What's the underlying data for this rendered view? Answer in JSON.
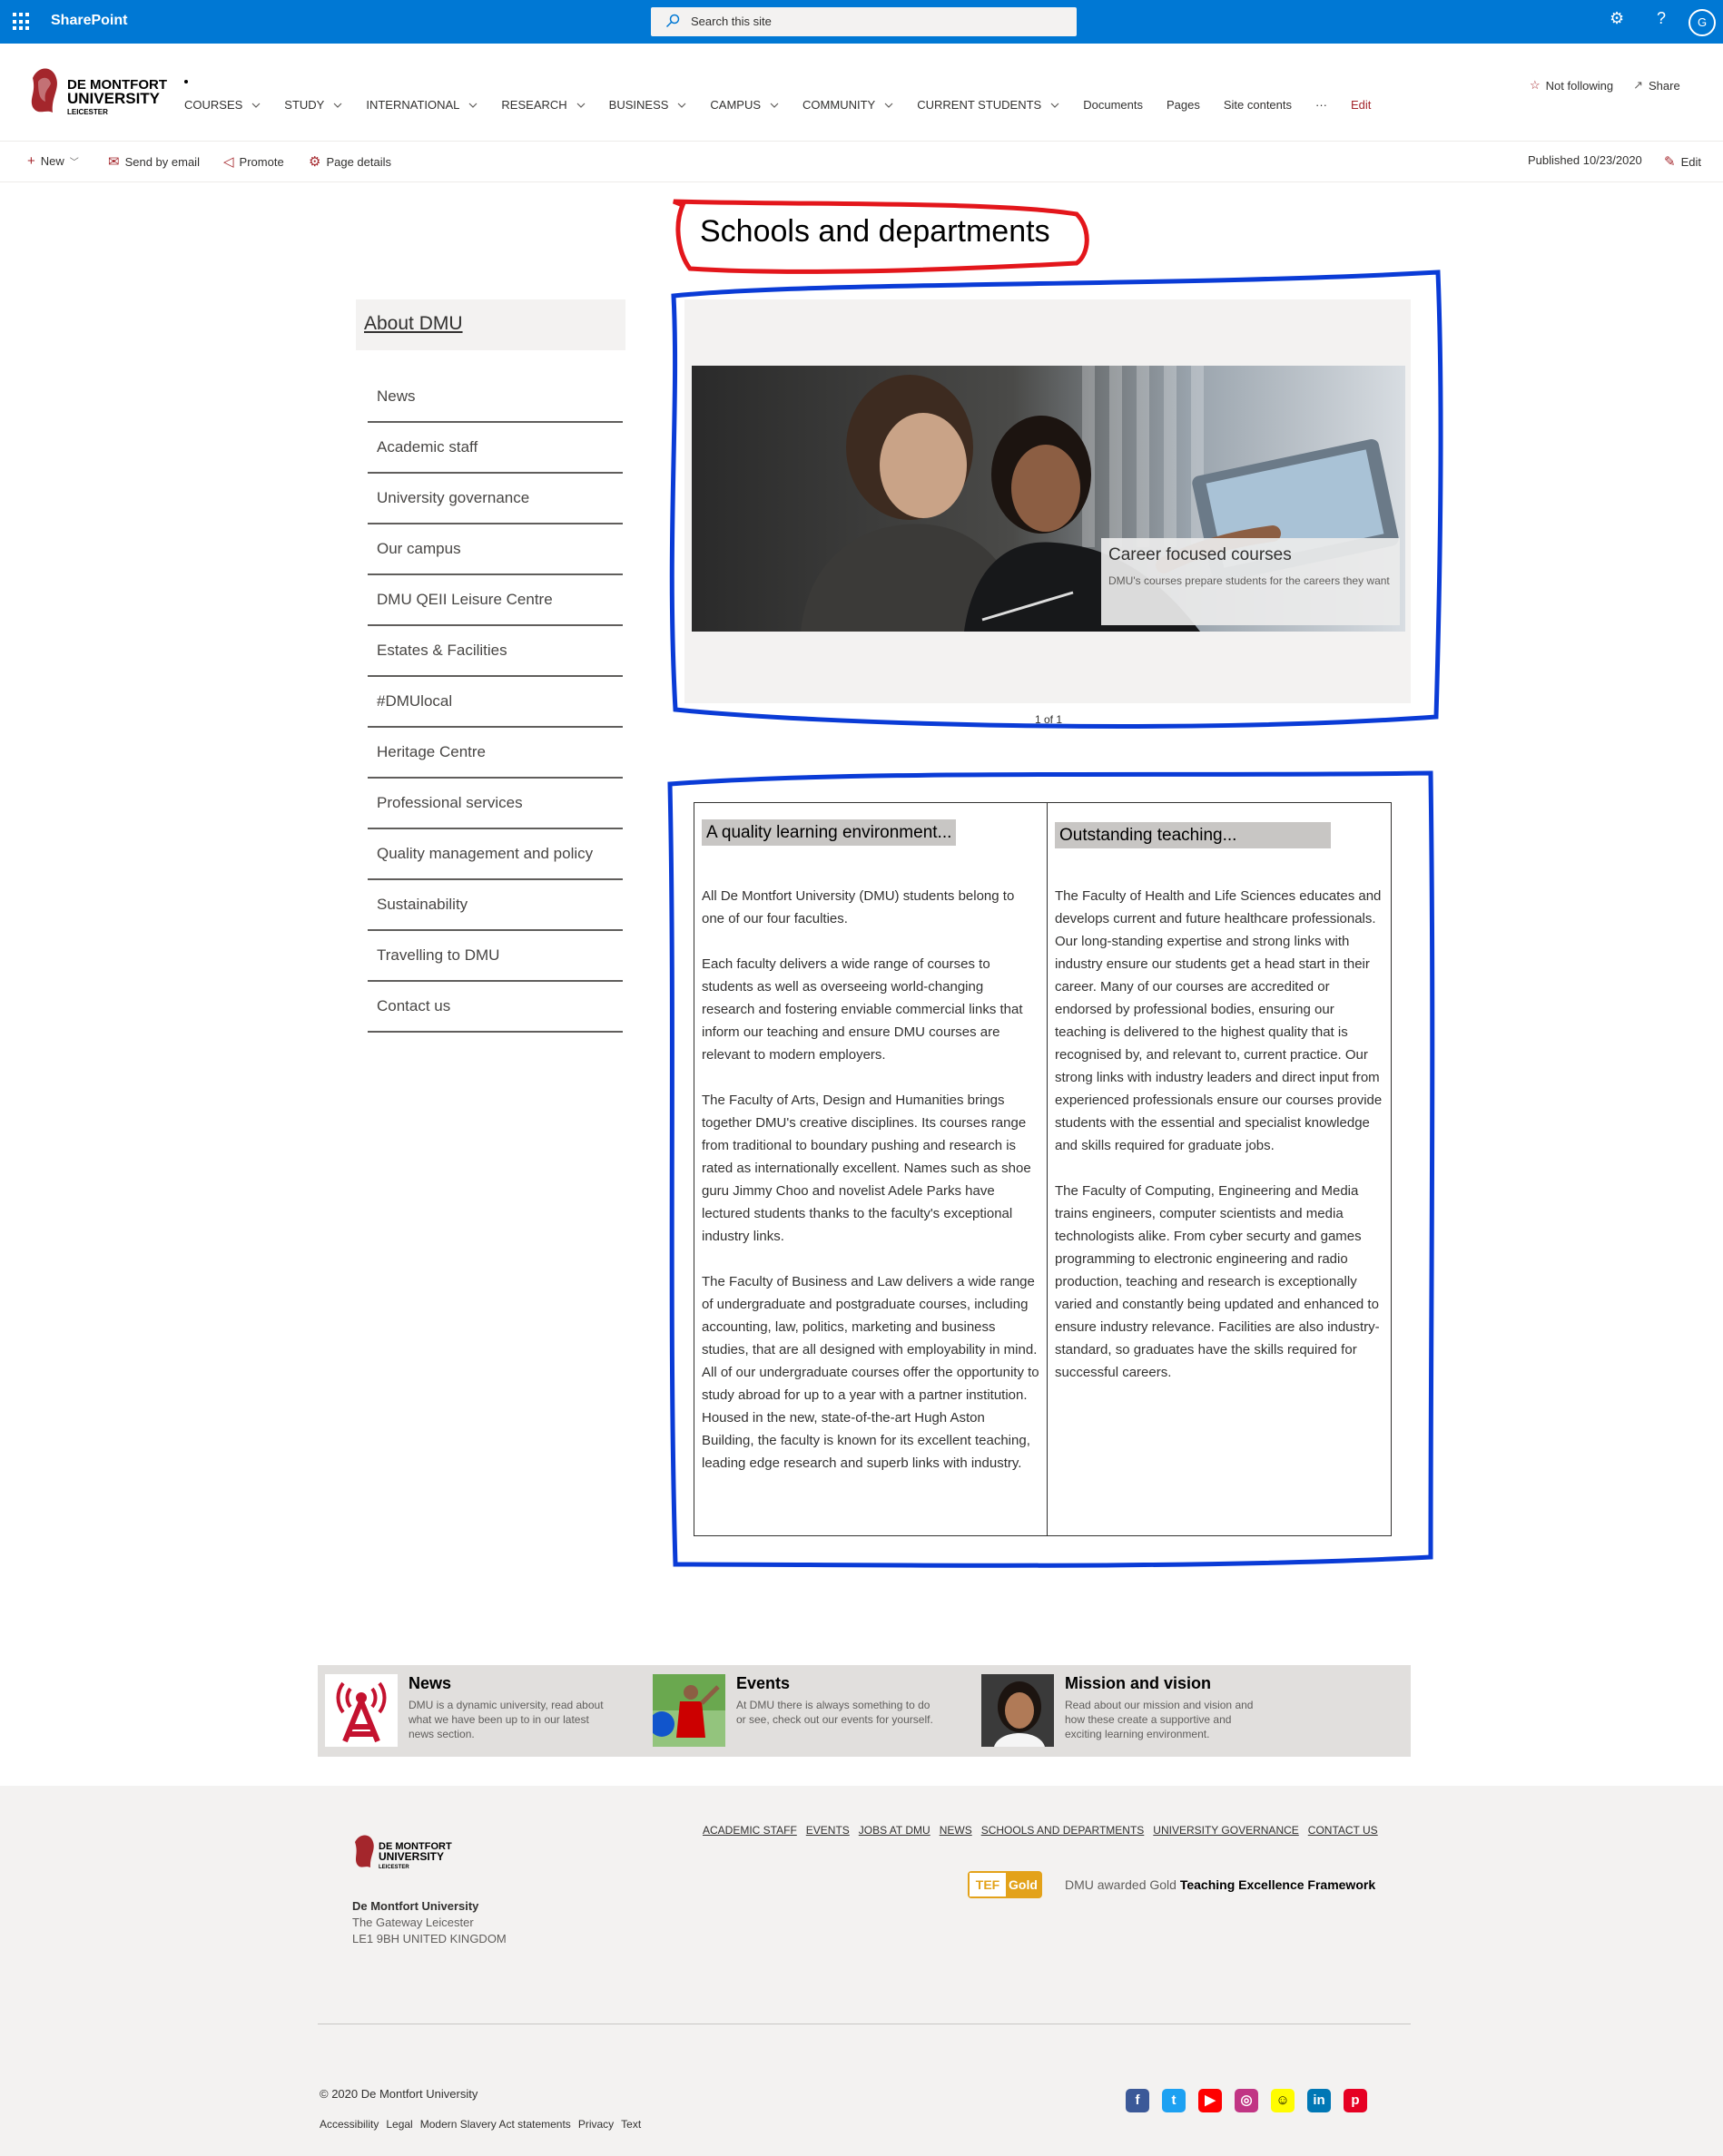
{
  "suite_bar": {
    "app_name": "SharePoint",
    "search_placeholder": "Search this site",
    "avatar_initial": "G"
  },
  "site_header": {
    "logo_lines": [
      "DE MONTFORT",
      "UNIVERSITY",
      "LEICESTER"
    ],
    "nav": [
      {
        "label": "COURSES",
        "dropdown": true
      },
      {
        "label": "STUDY",
        "dropdown": true
      },
      {
        "label": "INTERNATIONAL",
        "dropdown": true
      },
      {
        "label": "RESEARCH",
        "dropdown": true
      },
      {
        "label": "BUSINESS",
        "dropdown": true
      },
      {
        "label": "CAMPUS",
        "dropdown": true
      },
      {
        "label": "COMMUNITY",
        "dropdown": true
      },
      {
        "label": "CURRENT STUDENTS",
        "dropdown": true
      },
      {
        "label": "Documents",
        "dropdown": false
      },
      {
        "label": "Pages",
        "dropdown": false
      },
      {
        "label": "Site contents",
        "dropdown": false
      }
    ],
    "more": "···",
    "edit": "Edit",
    "not_following": "Not following",
    "share": "Share"
  },
  "command_bar": {
    "new": "New",
    "send_by_email": "Send by email",
    "promote": "Promote",
    "page_details": "Page details",
    "published": "Published 10/23/2020",
    "edit": "Edit"
  },
  "page": {
    "title": "Schools and departments"
  },
  "left_nav": {
    "header": "About DMU",
    "items": [
      "News",
      "Academic staff",
      "University governance",
      "Our campus",
      "DMU QEII Leisure Centre",
      "Estates & Facilities",
      "#DMUlocal",
      "Heritage Centre",
      "Professional services",
      "Quality management and policy",
      "Sustainability",
      "Travelling to DMU",
      "Contact us"
    ]
  },
  "carousel": {
    "caption_title": "Career focused courses",
    "caption_desc": "DMU's courses prepare students for the careers they want",
    "pager": "1 of 1"
  },
  "content": {
    "left": {
      "heading": "A quality learning environment...",
      "paragraphs": [
        "All De Montfort University (DMU) students belong to one of our four faculties.",
        "Each faculty delivers a wide range of courses to students as well as overseeing world-changing research and fostering enviable commercial links that inform our teaching and ensure DMU courses are relevant to modern employers.",
        "The Faculty of Arts, Design and Humanities brings together DMU's creative disciplines. Its courses range from traditional to boundary pushing and research is rated as internationally excellent. Names such as shoe guru Jimmy Choo and novelist Adele Parks have lectured students thanks to the faculty's exceptional industry links.",
        "The Faculty of Business and Law delivers a wide range of undergraduate and postgraduate courses, including accounting, law, politics, marketing and business studies, that are all designed with employability in mind. All of our undergraduate courses offer the opportunity to study abroad for up to a year with a partner institution. Housed in the new, state-of-the-art Hugh Aston Building, the faculty is known for its excellent teaching, leading edge research and superb links with industry."
      ]
    },
    "right": {
      "heading": "Outstanding teaching...",
      "paragraphs": [
        "The Faculty of Health and Life Sciences educates and develops current and future healthcare professionals. Our long-standing expertise and strong links with industry ensure our students get a head start in their career. Many of our courses are accredited or endorsed by professional bodies, ensuring our teaching is delivered to the highest quality that is recognised by, and relevant to, current practice. Our strong links with industry leaders and direct input from experienced professionals ensure our courses provide students with the essential and specialist knowledge and skills required for graduate jobs.",
        "The Faculty of Computing, Engineering and Media trains engineers, computer scientists and media technologists alike. From cyber securty and games programming to electronic engineering and radio production, teaching and research is exceptionally varied and constantly being updated and enhanced to ensure industry relevance. Facilities are also industry-standard, so graduates have the skills required for successful careers."
      ]
    }
  },
  "quick_links": [
    {
      "title": "News",
      "desc": "DMU is a dynamic university, read about what we have been up to in our latest news section."
    },
    {
      "title": "Events",
      "desc": "At DMU there is always something to do or see, check out our events for yourself."
    },
    {
      "title": "Mission and vision",
      "desc": "Read about our mission and vision and how these create a supportive and exciting learning environment."
    }
  ],
  "footer": {
    "org_name": "De Montfort University",
    "address_line1": "The Gateway   Leicester",
    "address_line2": "LE1 9BH   UNITED KINGDOM",
    "links": [
      "ACADEMIC STAFF",
      "EVENTS",
      "JOBS AT DMU",
      "NEWS",
      "SCHOOLS AND DEPARTMENTS",
      "UNIVERSITY GOVERNANCE",
      "CONTACT US"
    ],
    "tef_left": "TEF",
    "tef_right": "Gold",
    "tef_note_prefix": "DMU awarded Gold ",
    "tef_note_bold": "Teaching Excellence Framework",
    "copyright": "© 2020 De Montfort University",
    "legal": [
      "Accessibility",
      "Legal",
      "Modern Slavery Act statements",
      "Privacy",
      "Text"
    ],
    "social": [
      {
        "name": "facebook-icon",
        "glyph": "f",
        "color": "#3b5998"
      },
      {
        "name": "twitter-icon",
        "glyph": "t",
        "color": "#1da1f2"
      },
      {
        "name": "youtube-icon",
        "glyph": "▶",
        "color": "#ff0000"
      },
      {
        "name": "instagram-icon",
        "glyph": "◎",
        "color": "#c13584"
      },
      {
        "name": "snapchat-icon",
        "glyph": "☺",
        "color": "#fffc00"
      },
      {
        "name": "linkedin-icon",
        "glyph": "in",
        "color": "#0077b5"
      },
      {
        "name": "pinterest-icon",
        "glyph": "p",
        "color": "#e60023"
      }
    ]
  },
  "colors": {
    "suite_bar": "#0078d4",
    "accent_red": "#a4262c",
    "annotation_red": "#e3161b",
    "annotation_blue": "#0a3bd6"
  }
}
